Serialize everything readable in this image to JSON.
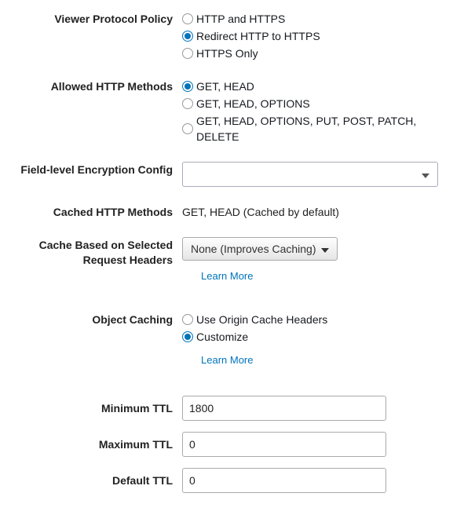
{
  "viewerProtocolPolicy": {
    "label": "Viewer Protocol Policy",
    "options": [
      "HTTP and HTTPS",
      "Redirect HTTP to HTTPS",
      "HTTPS Only"
    ],
    "selected": 1
  },
  "allowedHttpMethods": {
    "label": "Allowed HTTP Methods",
    "options": [
      "GET, HEAD",
      "GET, HEAD, OPTIONS",
      "GET, HEAD, OPTIONS, PUT, POST, PATCH, DELETE"
    ],
    "selected": 0
  },
  "fieldLevelEncryption": {
    "label": "Field-level Encryption Config",
    "selected": ""
  },
  "cachedHttpMethods": {
    "label": "Cached HTTP Methods",
    "value": "GET, HEAD (Cached by default)"
  },
  "cacheRequestHeaders": {
    "label": "Cache Based on Selected Request Headers",
    "selected": "None (Improves Caching)",
    "learnMore": "Learn More"
  },
  "objectCaching": {
    "label": "Object Caching",
    "options": [
      "Use Origin Cache Headers",
      "Customize"
    ],
    "selected": 1,
    "learnMore": "Learn More"
  },
  "minTTL": {
    "label": "Minimum TTL",
    "value": "1800"
  },
  "maxTTL": {
    "label": "Maximum TTL",
    "value": "0"
  },
  "defaultTTL": {
    "label": "Default TTL",
    "value": "0"
  }
}
